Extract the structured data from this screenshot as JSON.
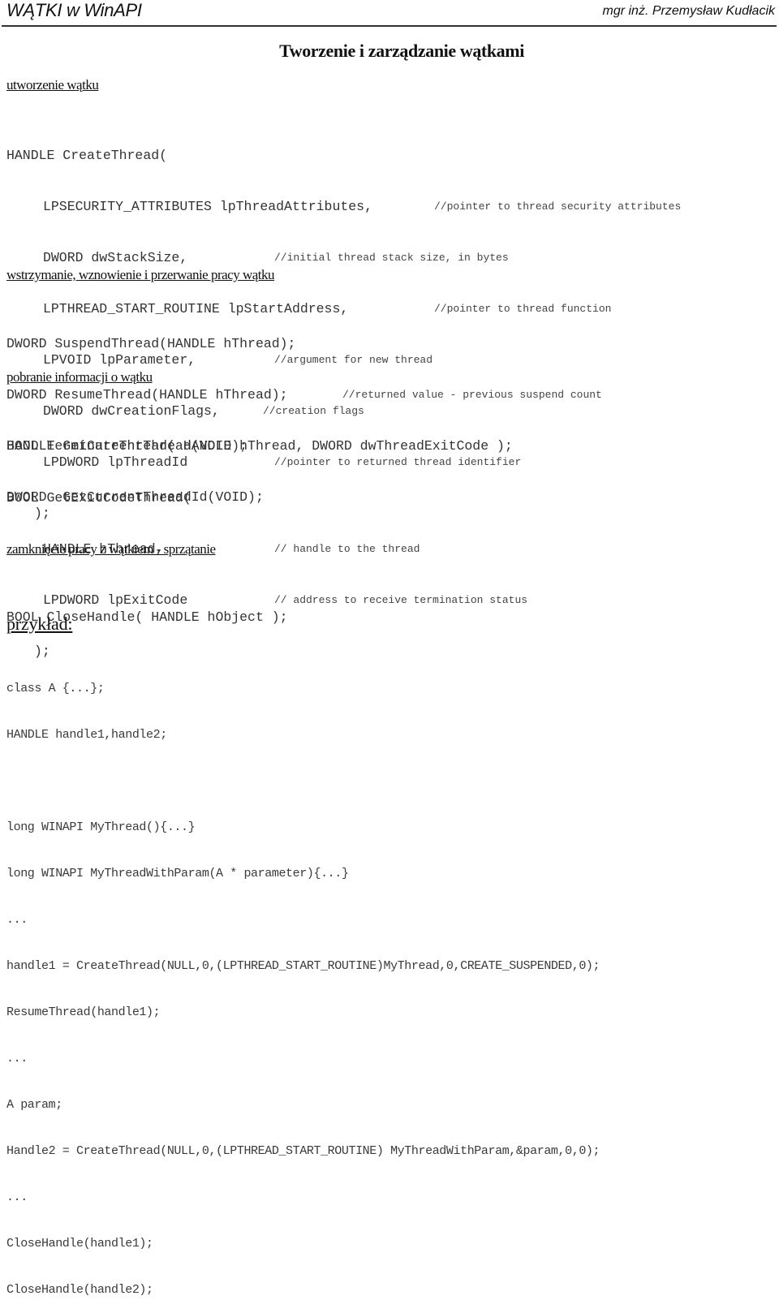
{
  "header": {
    "title": "WĄTKI w WinAPI",
    "author": "mgr inż. Przemysław Kudłacik"
  },
  "page_title": "Tworzenie i zarządzanie wątkami",
  "sections": {
    "create": {
      "heading": "utworzenie wątku",
      "lines": [
        {
          "code": "HANDLE CreateThread(",
          "comment": ""
        },
        {
          "code": "LPSECURITY_ATTRIBUTES lpThreadAttributes,",
          "comment": "//pointer to thread security attributes"
        },
        {
          "code": "DWORD dwStackSize,",
          "comment": "//initial thread stack size, in bytes"
        },
        {
          "code": "LPTHREAD_START_ROUTINE lpStartAddress,",
          "comment": "//pointer to thread function"
        },
        {
          "code": "LPVOID lpParameter,",
          "comment": "//argument for new thread"
        },
        {
          "code": "DWORD dwCreationFlags,",
          "comment": "//creation flags"
        },
        {
          "code": "LPDWORD lpThreadId",
          "comment": "//pointer to returned thread identifier"
        },
        {
          "code": ");",
          "comment": ""
        }
      ]
    },
    "suspend": {
      "heading": "wstrzymanie, wznowienie i przerwanie pracy wątku",
      "lines": [
        {
          "code": "DWORD SuspendThread(HANDLE hThread);",
          "comment": ""
        },
        {
          "code": "DWORD ResumeThread(HANDLE hThread);",
          "comment": "//returned value - previous suspend count"
        },
        {
          "code": "BOOL TerminateThread( HANDLE hThread, DWORD dwThreadExitCode );",
          "comment": ""
        }
      ]
    },
    "info": {
      "heading": "pobranie informacji o wątku",
      "lines": [
        {
          "code": "HANDLE GetCurrentThread(VOID);",
          "comment": ""
        },
        {
          "code": "DWORD  GetCurrentThreadId(VOID);",
          "comment": ""
        }
      ],
      "exitcode_lines": [
        {
          "code": "BOOL GetExitCodeThread(",
          "comment": ""
        },
        {
          "code": "HANDLE hThread,",
          "comment": "// handle to the thread"
        },
        {
          "code": "LPDWORD lpExitCode",
          "comment": "// address to receive termination status"
        },
        {
          "code": ");",
          "comment": ""
        }
      ]
    },
    "close": {
      "heading": "zamknięcie pracy z wątkiem - sprzątanie",
      "code": "BOOL CloseHandle( HANDLE hObject );"
    },
    "example": {
      "heading": "przykład:",
      "lines": [
        "class A {...};",
        "HANDLE handle1,handle2;",
        "",
        "long WINAPI MyThread(){...}",
        "long WINAPI MyThreadWithParam(A * parameter){...}",
        "...",
        "handle1 = CreateThread(NULL,0,(LPTHREAD_START_ROUTINE)MyThread,0,CREATE_SUSPENDED,0);",
        "ResumeThread(handle1);",
        "...",
        "A param;",
        "Handle2 = CreateThread(NULL,0,(LPTHREAD_START_ROUTINE) MyThreadWithParam,&param,0,0);",
        "...",
        "CloseHandle(handle1);",
        "CloseHandle(handle2);"
      ]
    }
  }
}
